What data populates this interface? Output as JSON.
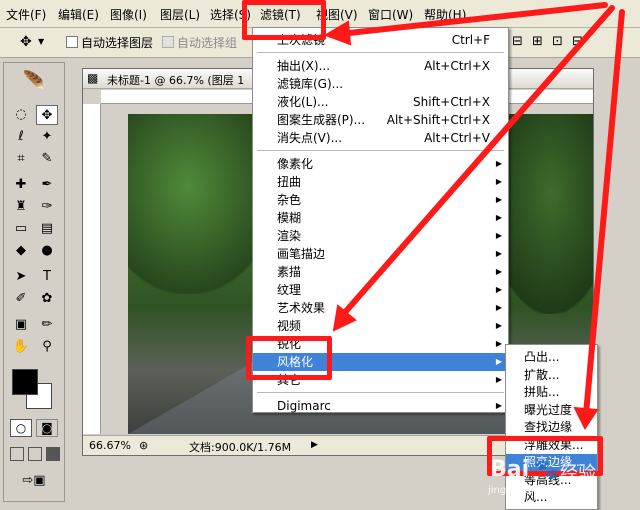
{
  "menubar": {
    "items": [
      "文件(F)",
      "编辑(E)",
      "图像(I)",
      "图层(L)",
      "选择(S)",
      "滤镜(T)",
      "视图(V)",
      "窗口(W)",
      "帮助(H)"
    ]
  },
  "options": {
    "auto_select_layer": "自动选择图层",
    "auto_select_group": "自动选择组"
  },
  "document": {
    "title": "未标题-1 @ 66.7% (图层 1",
    "zoom": "66.67%",
    "doc_info": "文档:900.0K/1.76M"
  },
  "filter_menu": {
    "items": [
      {
        "label": "上次滤镜",
        "shortcut": "Ctrl+F"
      },
      {
        "sep": true
      },
      {
        "label": "抽出(X)...",
        "shortcut": "Alt+Ctrl+X"
      },
      {
        "label": "滤镜库(G)...",
        "shortcut": ""
      },
      {
        "label": "液化(L)...",
        "shortcut": "Shift+Ctrl+X"
      },
      {
        "label": "图案生成器(P)...",
        "shortcut": "Alt+Shift+Ctrl+X"
      },
      {
        "label": "消失点(V)...",
        "shortcut": "Alt+Ctrl+V"
      },
      {
        "sep": true
      },
      {
        "label": "像素化",
        "submenu": true
      },
      {
        "label": "扭曲",
        "submenu": true
      },
      {
        "label": "杂色",
        "submenu": true
      },
      {
        "label": "模糊",
        "submenu": true
      },
      {
        "label": "渲染",
        "submenu": true
      },
      {
        "label": "画笔描边",
        "submenu": true
      },
      {
        "label": "素描",
        "submenu": true
      },
      {
        "label": "纹理",
        "submenu": true
      },
      {
        "label": "艺术效果",
        "submenu": true
      },
      {
        "label": "视频",
        "submenu": true
      },
      {
        "label": "锐化",
        "submenu": true
      },
      {
        "label": "风格化",
        "submenu": true,
        "highlighted": true
      },
      {
        "label": "其它",
        "submenu": true
      },
      {
        "sep": true
      },
      {
        "label": "Digimarc",
        "submenu": true
      }
    ]
  },
  "submenu": {
    "items": [
      {
        "label": "凸出..."
      },
      {
        "label": "扩散..."
      },
      {
        "label": "拼贴..."
      },
      {
        "label": "曝光过度"
      },
      {
        "label": "查找边缘"
      },
      {
        "label": "浮雕效果..."
      },
      {
        "label": "照亮边缘...",
        "highlighted": true
      },
      {
        "label": "等高线..."
      },
      {
        "label": "风..."
      }
    ]
  },
  "watermark": {
    "brand": "Bai",
    "suffix": "经验",
    "url": "jingyan.baidu.com"
  },
  "colors": {
    "highlight": "#3f83d8",
    "annotation": "#ff1a1a"
  }
}
